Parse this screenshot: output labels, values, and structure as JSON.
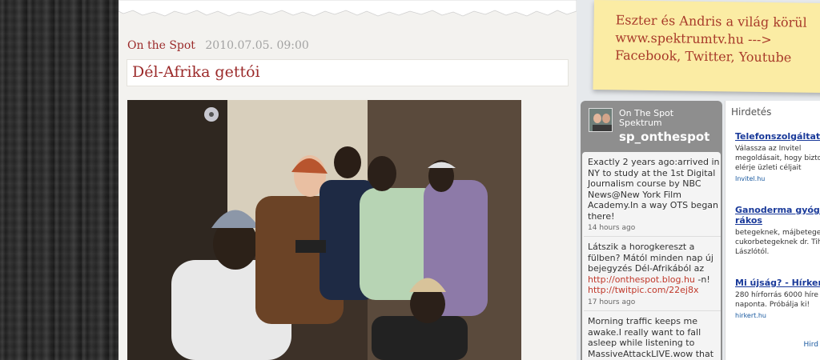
{
  "post": {
    "category": "On the Spot",
    "date": "2010.07.05. 09:00",
    "title": "Dél-Afrika gettói"
  },
  "sticky_note": {
    "line1": "Eszter és Andris a világ körül",
    "line2": "www.spektrumtv.hu --->",
    "line3": "Facebook, Twitter, Youtube"
  },
  "twitter": {
    "name_line1": "On The Spot",
    "name_line2": "Spektrum",
    "handle": "sp_onthespot",
    "tweets": [
      {
        "text": "Exactly 2 years ago:arrived in NY to study at the 1st Digital Journalism course by NBC News@New York Film Academy.In a way OTS began there!",
        "time": "14 hours ago"
      },
      {
        "text": "Látszik a horogkereszt a fülben? Mától minden nap új bejegyzés Dél-Afrikából az",
        "link1": "http://onthespot.blog.hu",
        "mid": " -n!",
        "link2": "http://twitpic.com/22ej8x",
        "time": "17 hours ago"
      },
      {
        "text": "Morning traffic keeps me awake.I really want to fall asleep while listening to MassiveAttackLIVE.wow that"
      }
    ]
  },
  "ads": {
    "heading": "Hirdetés",
    "items": [
      {
        "title": "Telefonszolgáltatás",
        "text1": "Válassza az Invitel",
        "text2": "megoldásait, hogy bizto",
        "text3": "elérje üzleti céljait",
        "url": "Invitel.hu"
      },
      {
        "title": "Ganoderma gyógygo",
        "title2": "rákos",
        "text1": "betegeknek, májbetege",
        "text2": "cukorbetegeknek dr. Tih",
        "text3": "Lászlótól."
      },
      {
        "title": "Mi újság? - Hírkert",
        "text1": "280 hírforrás 6000 híre",
        "text2": "naponta. Próbálja ki!",
        "url": "hirkert.hu"
      }
    ],
    "more": "Hird"
  },
  "colors": {
    "accent_red": "#9b2a2a",
    "sticky_yellow": "#fbeca4",
    "ad_link_blue": "#1a3a9a"
  }
}
